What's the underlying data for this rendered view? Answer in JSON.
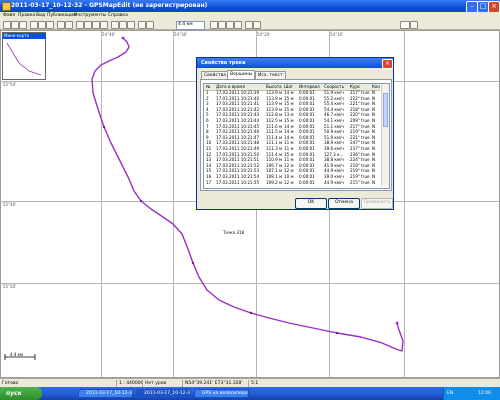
{
  "window": {
    "title": "2011-03-17_10-12-32 - GPSMapEdit (не зарегистрирован)",
    "colors": {
      "titlebar": "#0a4fd8",
      "track": "#9a2fc5",
      "face": "#ece9d8"
    }
  },
  "menu": [
    "Файл",
    "Правка",
    "Вид",
    "Публикация",
    "Инструменты",
    "Справка"
  ],
  "toolbar": {
    "zoom_value": "4.4 км"
  },
  "map": {
    "grid_labels": [
      "55°50'",
      "55°40'",
      "55°20'",
      "54°50'",
      "54°40'",
      "54°30'",
      "54°20'",
      "54°10'"
    ],
    "waypoint_label": "Точка 318",
    "scale_label": "4.4 км",
    "overview_title": "Мини-карта"
  },
  "dialog": {
    "title": "Свойства трека",
    "tabs": [
      "Свойства",
      "Вершины",
      "Исх. текст"
    ],
    "active_tab": "Вершины",
    "columns": [
      "№",
      "Дата и время",
      "Высота",
      "Шаг",
      "Интервал",
      "Скорость",
      "Курс",
      "Кон"
    ],
    "rows": [
      [
        "1",
        "17.03.2011 10:21:39",
        "113.9 м",
        "14 м",
        "0:00:01",
        "51.9 км/ч",
        "217° true",
        "N"
      ],
      [
        "2",
        "17.03.2011 10:21:40",
        "113.9 м",
        "15 м",
        "0:00:01",
        "55.2 км/ч",
        "222° true",
        "N"
      ],
      [
        "3",
        "17.03.2011 10:21:41",
        "113.9 м",
        "15 м",
        "0:00:01",
        "55.4 км/ч",
        "221° true",
        "N"
      ],
      [
        "4",
        "17.03.2011 10:21:42",
        "113.9 м",
        "15 м",
        "0:00:01",
        "54.4 км/ч",
        "218° true",
        "N"
      ],
      [
        "5",
        "17.03.2011 10:21:43",
        "112.8 м",
        "13 м",
        "0:00:01",
        "46.7 км/ч",
        "220° true",
        "N"
      ],
      [
        "6",
        "17.03.2011 10:21:44",
        "112.5 м",
        "15 м",
        "0:00:01",
        "54.1 км/ч",
        "209° true",
        "N"
      ],
      [
        "7",
        "17.03.2011 10:21:45",
        "111.6 м",
        "14 м",
        "0:00:01",
        "51.1 км/ч",
        "217° true",
        "N"
      ],
      [
        "8",
        "17.03.2011 10:21:46",
        "111.5 м",
        "14 м",
        "0:00:01",
        "50.9 км/ч",
        "219° true",
        "N"
      ],
      [
        "9",
        "17.03.2011 10:21:47",
        "111.4 м",
        "14 м",
        "0:00:01",
        "51.9 км/ч",
        "221° true",
        "N"
      ],
      [
        "10",
        "17.03.2011 10:21:48",
        "111.1 м",
        "11 м",
        "0:00:01",
        "38.9 км/ч",
        "247° true",
        "N"
      ],
      [
        "11",
        "17.03.2011 10:21:49",
        "111.3 м",
        "11 м",
        "0:00:01",
        "39.6 км/ч",
        "237° true",
        "N"
      ],
      [
        "12",
        "17.03.2011 10:21:50",
        "111.4 м",
        "35 м",
        "0:00:01",
        "127.3 к...",
        "236° true",
        "N"
      ],
      [
        "13",
        "17.03.2011 10:21:51",
        "110.9 м",
        "11 м",
        "0:00:01",
        "38.8 км/ч",
        "224° true",
        "N"
      ],
      [
        "14",
        "17.03.2011 10:21:52",
        "106.7 м",
        "12 м",
        "0:00:01",
        "41.9 км/ч",
        "219° true",
        "N"
      ],
      [
        "15",
        "17.03.2011 10:21:53",
        "107.1 м",
        "12 м",
        "0:00:01",
        "44.9 км/ч",
        "219° true",
        "N"
      ],
      [
        "16",
        "17.03.2011 10:21:54",
        "108.1 м",
        "10 м",
        "0:00:01",
        "39.0 км/ч",
        "219° true",
        "N"
      ],
      [
        "17",
        "17.03.2011 10:21:55",
        "109.2 м",
        "12 м",
        "0:00:01",
        "44.9 км/ч",
        "215° true",
        "N"
      ]
    ],
    "buttons": {
      "ok": "OK",
      "cancel": "Отмена",
      "apply": "Применить"
    }
  },
  "status": {
    "ready": "Готово",
    "scale": "1 : 440000",
    "level": "Нет уров",
    "coords": "N54°39.241' E73°31.328'",
    "zoom": "5:1"
  },
  "taskbar": {
    "start": "пуск",
    "tasks": [
      "2011-03-17_10-12-3...",
      "2011-03-17_10-12-3...",
      "GPS на велосипеде..."
    ],
    "lang": "EN",
    "time": "12:06"
  }
}
